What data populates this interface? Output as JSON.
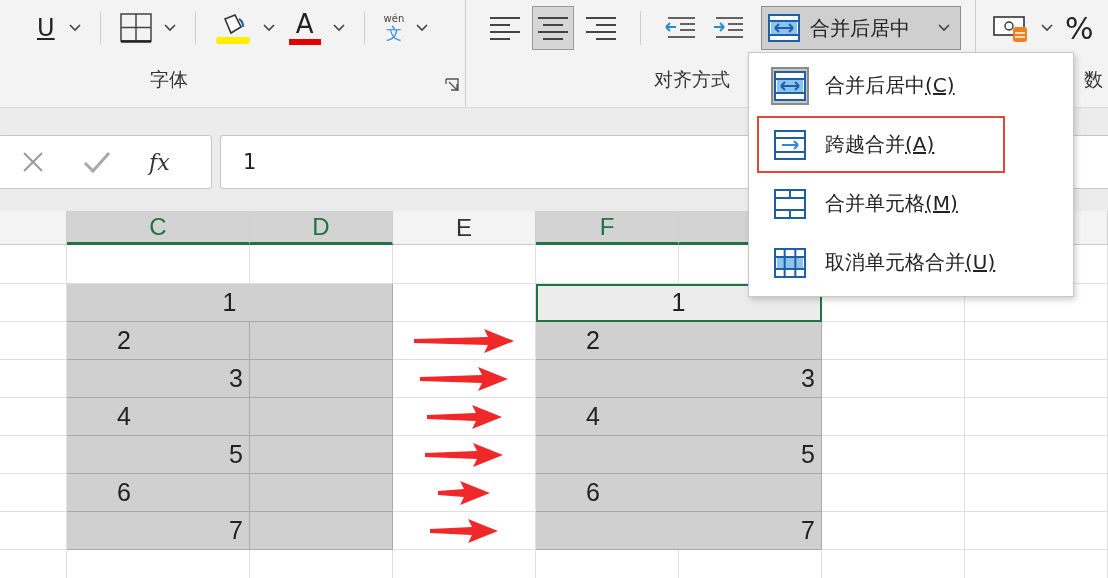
{
  "ribbon": {
    "font_group": {
      "label": "字体",
      "underline_label": "U",
      "font_color_label": "A",
      "phonetic_guide": {
        "ruby": "wén",
        "base": "文"
      }
    },
    "alignment_group": {
      "label": "对齐方式",
      "align_buttons": [
        {
          "kind": "left",
          "selected": false
        },
        {
          "kind": "center",
          "selected": true
        },
        {
          "kind": "right",
          "selected": false
        }
      ],
      "merge_button": {
        "label": "合并后居中",
        "expanded": true
      }
    },
    "number_group": {
      "label": "数",
      "percent_label": "%"
    }
  },
  "formula_bar": {
    "function_label": "fx",
    "value": "1"
  },
  "sheet": {
    "columns": [
      {
        "selected": false
      },
      {
        "label": "C",
        "selected": true
      },
      {
        "label": "D",
        "selected": true
      },
      {
        "label": "E",
        "selected": false
      },
      {
        "label": "F",
        "selected": true
      },
      {
        "selected": true
      }
    ],
    "before_table": {
      "rows": [
        {
          "value": "1",
          "kind": "center",
          "merged": true
        },
        {
          "value": "2",
          "kind": "left",
          "merged": false
        },
        {
          "value": "3",
          "kind": "right",
          "merged": false
        },
        {
          "value": "4",
          "kind": "left",
          "merged": false
        },
        {
          "value": "5",
          "kind": "right",
          "merged": false
        },
        {
          "value": "6",
          "kind": "left",
          "merged": false
        },
        {
          "value": "7",
          "kind": "right",
          "merged": false
        }
      ]
    },
    "after_table": {
      "rows": [
        {
          "value": "1",
          "kind": "center",
          "merged": true,
          "selected": true
        },
        {
          "value": "2",
          "kind": "left",
          "merged": true,
          "selected": false
        },
        {
          "value": "3",
          "kind": "right",
          "merged": true,
          "selected": false
        },
        {
          "value": "4",
          "kind": "left",
          "merged": true,
          "selected": false
        },
        {
          "value": "5",
          "kind": "right",
          "merged": true,
          "selected": false
        },
        {
          "value": "6",
          "kind": "left",
          "merged": true,
          "selected": false
        },
        {
          "value": "7",
          "kind": "right",
          "merged": true,
          "selected": false
        }
      ]
    }
  },
  "merge_menu": {
    "items": [
      {
        "kind": "center",
        "label": "合并后居中",
        "access_key": "(C)",
        "selected": true,
        "highlighted": false
      },
      {
        "kind": "across",
        "label": "跨越合并",
        "access_key": "(A)",
        "selected": false,
        "highlighted": true
      },
      {
        "kind": "merge",
        "label": "合并单元格",
        "access_key": "(M)",
        "selected": false,
        "highlighted": false
      },
      {
        "kind": "unmerge",
        "label": "取消单元格合并",
        "access_key": "(U)",
        "selected": false,
        "highlighted": false
      }
    ]
  }
}
